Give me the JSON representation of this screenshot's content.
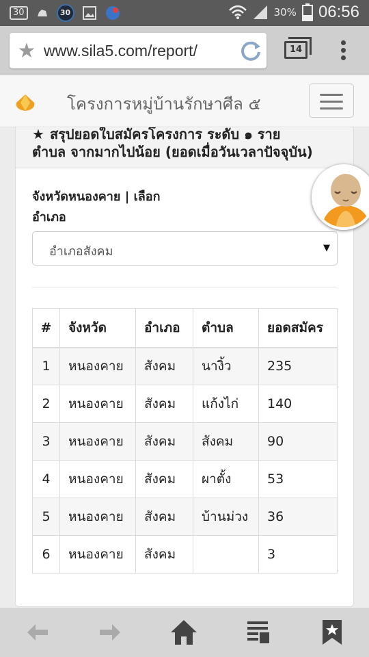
{
  "status_bar": {
    "notif_box": "30",
    "notif_badge": "30",
    "battery": "30%",
    "time": "06:56"
  },
  "browser": {
    "url": "www.sila5.com/report/",
    "tab_count": "14",
    "icons": [
      "star-icon",
      "reload-icon",
      "tabs-icon",
      "overflow-menu-icon"
    ]
  },
  "site": {
    "title": "โครงการหมู่บ้านรักษาศีล ๕"
  },
  "report": {
    "heading_line1": "สรุปยอดใบสมัครโครงการ ระดับ ๑ ราย",
    "heading_line2": "ตำบล จากมากไปน้อย (ยอดเมื่อวันเวลาปัจจุบัน)",
    "province_label": "จังหวัดหนองคาย | เลือก",
    "district_label": "อำเภอ",
    "district_selected": "อำเภอสังคม",
    "columns": [
      "#",
      "จังหวัด",
      "อำเภอ",
      "ตำบล",
      "ยอดสมัคร"
    ],
    "rows": [
      [
        "1",
        "หนองคาย",
        "สังคม",
        "นางิ้ว",
        "235"
      ],
      [
        "2",
        "หนองคาย",
        "สังคม",
        "แก้งไก่",
        "140"
      ],
      [
        "3",
        "หนองคาย",
        "สังคม",
        "สังคม",
        "90"
      ],
      [
        "4",
        "หนองคาย",
        "สังคม",
        "ผาตั้ง",
        "53"
      ],
      [
        "5",
        "หนองคาย",
        "สังคม",
        "บ้านม่วง",
        "36"
      ],
      [
        "6",
        "หนองคาย",
        "สังคม",
        "",
        "3"
      ]
    ]
  },
  "bottom_nav": {
    "icons": [
      "back-arrow-icon",
      "forward-arrow-icon",
      "home-icon",
      "reader-icon",
      "bookmarks-icon"
    ]
  },
  "colors": {
    "status_bar": "#5a5a5a",
    "browser_bar": "#cfcfcf",
    "bottom_bar": "#d6d6d6",
    "logo_orange": "#f0a020"
  }
}
